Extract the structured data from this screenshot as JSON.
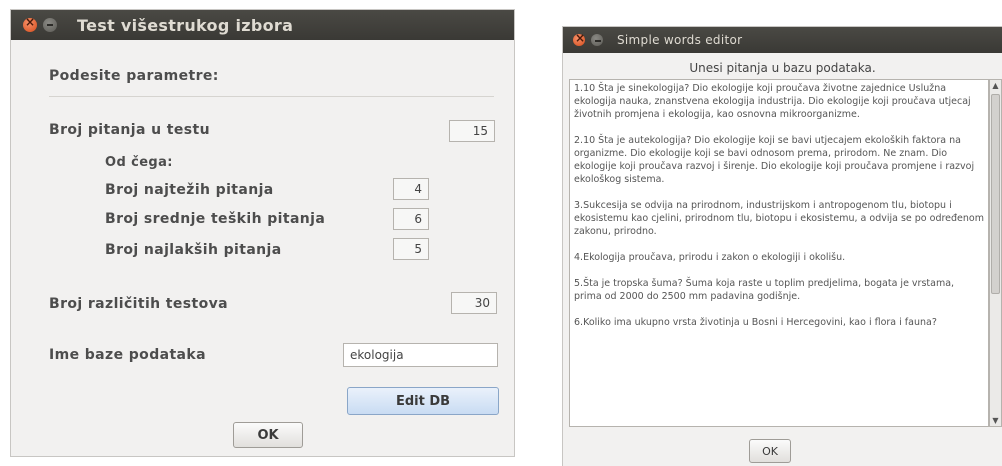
{
  "window1": {
    "title": "Test višestrukog izbora",
    "section_header": "Podesite parametre:",
    "questions_label": "Broj pitanja u testu",
    "questions_value": "15",
    "of_which_label": "Od čega:",
    "hardest_label": "Broj najtežih pitanja",
    "hardest_value": "4",
    "medium_label": "Broj srednje teških pitanja",
    "medium_value": "6",
    "easiest_label": "Broj najlakših pitanja",
    "easiest_value": "5",
    "tests_label": "Broj različitih testova",
    "tests_value": "30",
    "db_label": "Ime baze podataka",
    "db_value": "ekologija",
    "edit_db_button": "Edit DB",
    "ok_button": "OK"
  },
  "window2": {
    "title": "Simple words editor",
    "header": "Unesi pitanja u bazu podataka.",
    "paragraphs": [
      "1.10 Šta je sinekologija? Dio ekologije koji proučava životne zajednice Uslužna ekologija nauka, znanstvena ekologija industrija. Dio ekologije koji proučava utjecaj životnih promjena i ekologija, kao osnovna mikroorganizme.",
      "2.10 Šta je autekologija? Dio ekologije koji se bavi utjecajem ekoloških faktora na organizme. Dio ekologije koji se bavi odnosom prema, prirodom. Ne znam. Dio ekologije koji proučava razvoj i širenje. Dio ekologije koji proučava promjene i razvoj ekološkog sistema.",
      "3.Sukcesija se odvija na prirodnom, industrijskom i antropogenom tlu, biotopu i ekosistemu kao cjelini, prirodnom tlu, biotopu i ekosistemu, a odvija se po određenom zakonu, prirodno.",
      "4.Ekologija proučava, prirodu i zakon o ekologiji i okolišu.",
      "5.Šta je tropska šuma? Šuma koja raste u toplim predjelima, bogata je vrstama, prima od 2000 do 2500 mm padavina godišnje.",
      "6.Koliko ima ukupno vrsta životinja u Bosni i Hercegovini, kao i flora i fauna?"
    ],
    "ok_button": "OK"
  }
}
